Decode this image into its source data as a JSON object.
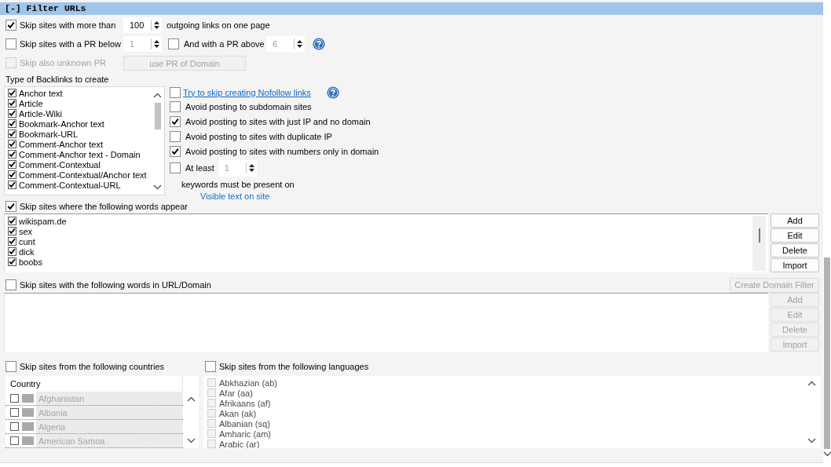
{
  "section": {
    "title": "[-] Filter URLs"
  },
  "outgoing_links": {
    "checked": true,
    "label": "Skip sites with more than",
    "value": "100",
    "disabled": false,
    "suffix": "outgoing links on one page"
  },
  "pr_below": {
    "checked": false,
    "label": "Skip sites with a PR below",
    "value": "1",
    "disabled": true
  },
  "pr_above": {
    "checked": false,
    "label": "And with a PR above",
    "value": "6",
    "disabled": true,
    "help": true
  },
  "unknown_pr": {
    "checked": false,
    "disabled": true,
    "label": "Skip also unknown PR"
  },
  "domain_pr_button": {
    "label": "use PR of Domain",
    "disabled": true
  },
  "backlink_types": {
    "label": "Type of Backlinks to create",
    "items": [
      {
        "label": "Anchor text",
        "checked": true
      },
      {
        "label": "Article",
        "checked": true
      },
      {
        "label": "Article-Wiki",
        "checked": true
      },
      {
        "label": "Bookmark-Anchor text",
        "checked": true
      },
      {
        "label": "Bookmark-URL",
        "checked": true
      },
      {
        "label": "Comment-Anchor text",
        "checked": true
      },
      {
        "label": "Comment-Anchor text - Domain",
        "checked": true
      },
      {
        "label": "Comment-Contextual",
        "checked": true
      },
      {
        "label": "Comment-Contextual/Anchor text",
        "checked": true
      },
      {
        "label": "Comment-Contextual-URL",
        "checked": true
      }
    ]
  },
  "options": [
    {
      "kind": "link",
      "label": "Try to skip creating Nofollow links",
      "checked": false,
      "help": true
    },
    {
      "kind": "plain",
      "label": "Avoid posting to subdomain sites",
      "checked": false
    },
    {
      "kind": "plain",
      "label": "Avoid posting to sites with just IP and no domain",
      "checked": true
    },
    {
      "kind": "plain",
      "label": "Avoid posting to sites with duplicate IP",
      "checked": false
    },
    {
      "kind": "plain",
      "label": "Avoid posting to sites with numbers only in domain",
      "checked": true
    }
  ],
  "keyword_presence": {
    "checked": false,
    "label": "At least",
    "value": "1",
    "disabled": true,
    "note": "keywords must be present on",
    "target": "Visible text on site"
  },
  "word_filter": {
    "checked": true,
    "label": "Skip sites where the following words appear",
    "words": [
      {
        "label": "wikispam.de",
        "checked": true
      },
      {
        "label": "sex",
        "checked": true
      },
      {
        "label": "cunt",
        "checked": true
      },
      {
        "label": "dick",
        "checked": true
      },
      {
        "label": "boobs",
        "checked": true
      }
    ],
    "buttons": [
      {
        "label": "Add",
        "disabled": false
      },
      {
        "label": "Edit",
        "disabled": false
      },
      {
        "label": "Delete",
        "disabled": false
      },
      {
        "label": "Import",
        "disabled": false
      }
    ]
  },
  "url_filter": {
    "checked": false,
    "label": "Skip sites with the following words in URL/Domain",
    "action": {
      "label": "Create Domain Filter",
      "disabled": true
    },
    "buttons": [
      {
        "label": "Add",
        "disabled": true
      },
      {
        "label": "Edit",
        "disabled": true
      },
      {
        "label": "Delete",
        "disabled": true
      },
      {
        "label": "Import",
        "disabled": true
      }
    ]
  },
  "countries": {
    "checked": false,
    "label": "Skip sites from the following countries",
    "column": "Country",
    "disabled": true,
    "items": [
      {
        "label": "Afghanistan",
        "checked": false
      },
      {
        "label": "Albania",
        "checked": false
      },
      {
        "label": "Algeria",
        "checked": false
      },
      {
        "label": "American Samoa",
        "checked": false
      }
    ]
  },
  "languages": {
    "checked": false,
    "label": "Skip sites from the following languages",
    "disabled": true,
    "items": [
      {
        "label": "Abkhazian (ab)",
        "checked": false
      },
      {
        "label": "Afar (aa)",
        "checked": false
      },
      {
        "label": "Afrikaans (af)",
        "checked": false
      },
      {
        "label": "Akan (ak)",
        "checked": false
      },
      {
        "label": "Albanian (sq)",
        "checked": false
      },
      {
        "label": "Amharic (am)",
        "checked": false
      },
      {
        "label": "Arabic (ar)",
        "checked": false
      }
    ]
  }
}
